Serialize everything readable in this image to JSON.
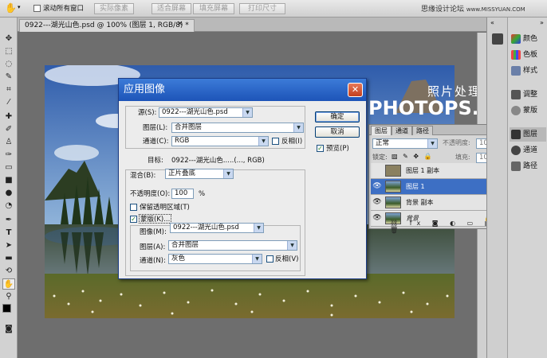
{
  "options_bar": {
    "scroll_all_label": "滚动所有窗口",
    "buttons": [
      "实际像素",
      "适合屏幕",
      "填充屏幕",
      "打印尺寸"
    ],
    "site_credit": "思缘设计论坛",
    "site_url": "www.MISSYUAN.COM"
  },
  "document": {
    "tab_title": "0922---湖光山色.psd @ 100% (图层 1, RGB/8) *",
    "watermark_cn": "照片处理网",
    "watermark_en": "PHOTOPS.COM"
  },
  "dialog": {
    "title": "应用图像",
    "source_label": "源(S):",
    "source_value": "0922---湖光山色.psd",
    "layer_label": "图层(L):",
    "layer_value": "合并图层",
    "channel_label": "通道(C):",
    "channel_value": "RGB",
    "invert_label": "反相(I)",
    "target_label": "目标:",
    "target_value": "0922---湖光山色.....(..., RGB)",
    "blending_label": "混合(B):",
    "blending_value": "正片叠底",
    "opacity_label": "不透明度(O):",
    "opacity_value": "100",
    "opacity_unit": "%",
    "preserve_label": "保留透明区域(T)",
    "mask_label": "蒙版(K)...",
    "mask_image_label": "图像(M):",
    "mask_image_value": "0922---湖光山色.psd",
    "mask_layer_label": "图层(A):",
    "mask_layer_value": "合并图层",
    "mask_channel_label": "通道(N):",
    "mask_channel_value": "灰色",
    "mask_invert_label": "反相(V)",
    "ok_label": "确定",
    "cancel_label": "取消",
    "preview_label": "预览(P)"
  },
  "layers_panel": {
    "tabs": [
      "图层",
      "通道",
      "路径"
    ],
    "blend_mode": "正常",
    "opacity_label": "不透明度:",
    "opacity_value": "100%",
    "lock_label": "锁定:",
    "fill_label": "填充:",
    "fill_value": "100%",
    "layers": [
      {
        "name": "图层 1 副本",
        "visible": false,
        "selected": false
      },
      {
        "name": "图层 1",
        "visible": true,
        "selected": true
      },
      {
        "name": "背景 副本",
        "visible": true,
        "selected": false
      },
      {
        "name": "背景",
        "visible": true,
        "selected": false
      }
    ]
  },
  "dock": {
    "items": [
      {
        "label": "颜色",
        "icon": "color-icon"
      },
      {
        "label": "色板",
        "icon": "swatches-icon"
      },
      {
        "label": "样式",
        "icon": "styles-icon"
      },
      {
        "label": "调整",
        "icon": "adjustments-icon"
      },
      {
        "label": "蒙版",
        "icon": "masks-icon"
      },
      {
        "label": "图层",
        "icon": "layers-icon"
      },
      {
        "label": "通道",
        "icon": "channels-icon"
      },
      {
        "label": "路径",
        "icon": "paths-icon"
      }
    ]
  },
  "colors": {
    "title_bar": "#1d54b8",
    "selected_layer": "#3d6fc4"
  }
}
